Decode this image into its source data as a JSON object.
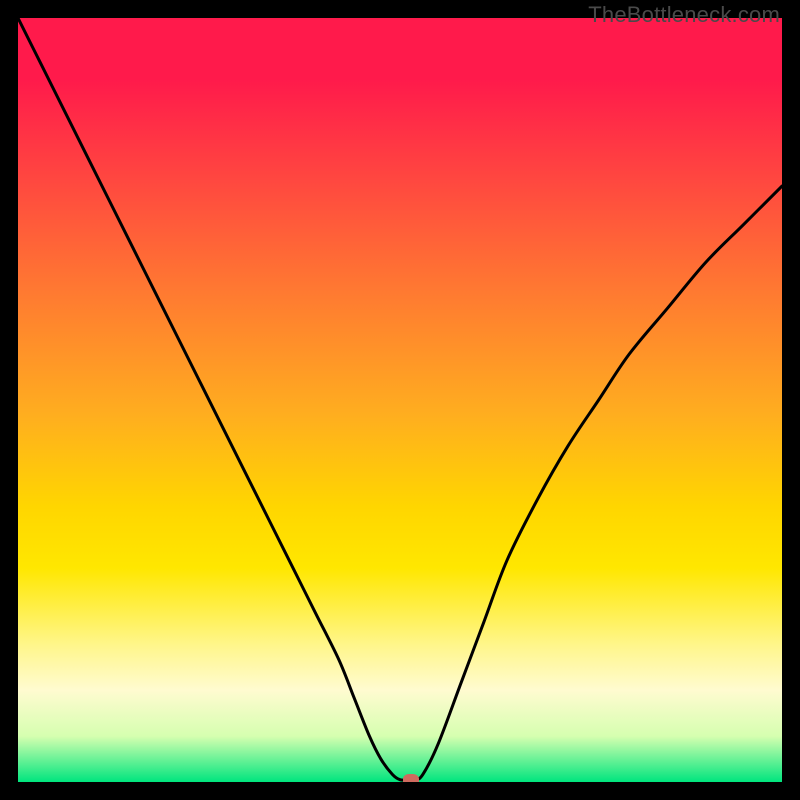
{
  "watermark": "TheBottleneck.com",
  "chart_data": {
    "type": "line",
    "title": "",
    "xlabel": "",
    "ylabel": "",
    "xlim": [
      0,
      100
    ],
    "ylim": [
      0,
      100
    ],
    "x": [
      0,
      3,
      6,
      9,
      12,
      15,
      18,
      21,
      24,
      27,
      30,
      33,
      36,
      39,
      42,
      44,
      46,
      47.5,
      49,
      50,
      51,
      52,
      53,
      55,
      58,
      61,
      64,
      68,
      72,
      76,
      80,
      85,
      90,
      95,
      100
    ],
    "values": [
      100,
      94,
      88,
      82,
      76,
      70,
      64,
      58,
      52,
      46,
      40,
      34,
      28,
      22,
      16,
      11,
      6,
      3,
      1,
      0.3,
      0.3,
      0.3,
      1,
      5,
      13,
      21,
      29,
      37,
      44,
      50,
      56,
      62,
      68,
      73,
      78
    ],
    "marker": {
      "x": 51.5,
      "y": 0.3
    },
    "gradient_stops": [
      {
        "pos": 0,
        "color": "#ff1a4b"
      },
      {
        "pos": 0.5,
        "color": "#ffd600"
      },
      {
        "pos": 0.9,
        "color": "#fffbd0"
      },
      {
        "pos": 1.0,
        "color": "#00e57e"
      }
    ]
  }
}
